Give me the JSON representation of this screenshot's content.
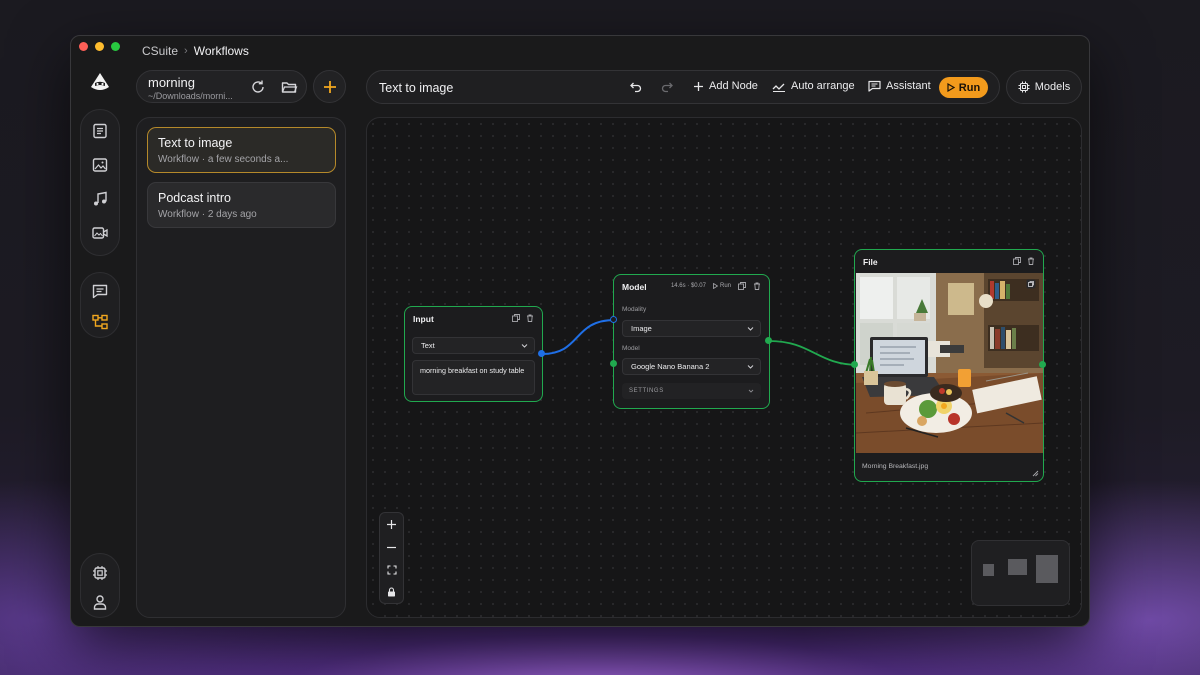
{
  "window": {
    "breadcrumb": [
      "CSuite",
      "Workflows"
    ]
  },
  "project": {
    "name": "morning",
    "path": "~/Downloads/morni..."
  },
  "workflows": [
    {
      "title": "Text to image",
      "subtitle": "Workflow · a few seconds a...",
      "active": true
    },
    {
      "title": "Podcast intro",
      "subtitle": "Workflow · 2 days ago",
      "active": false
    }
  ],
  "toolbar": {
    "title": "Text to image",
    "add_node": "Add Node",
    "auto_arrange": "Auto arrange",
    "assistant": "Assistant",
    "run": "Run",
    "models": "Models"
  },
  "nodes": {
    "input": {
      "title": "Input",
      "type_value": "Text",
      "prompt": "morning breakfast on study table"
    },
    "model": {
      "title": "Model",
      "stats": "14.6s · $0.07",
      "run_label": "Run",
      "modality_label": "Modality",
      "modality_value": "Image",
      "model_label": "Model",
      "model_value": "Google Nano Banana 2",
      "settings_label": "SETTINGS"
    },
    "file": {
      "title": "File",
      "filename": "Morning Breakfast.jpg"
    }
  },
  "colors": {
    "accent": "#f29a1c",
    "node_border": "#21a94f",
    "edge_blue": "#1f6fe6",
    "edge_green": "#21a94f"
  },
  "icons": {
    "rail": [
      "document-icon",
      "image-icon",
      "music-icon",
      "video-icon",
      "chat-icon",
      "workflow-icon",
      "chip-icon",
      "user-icon"
    ]
  }
}
